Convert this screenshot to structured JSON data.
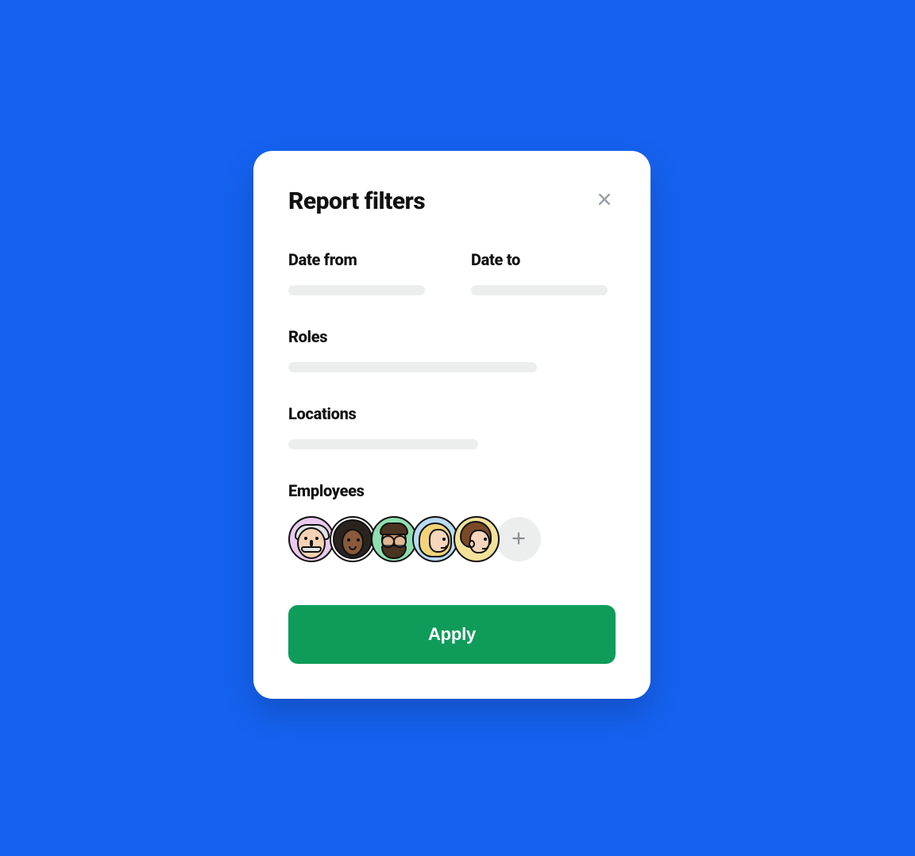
{
  "modal": {
    "title": "Report filters",
    "apply_label": "Apply"
  },
  "filters": {
    "date_from": {
      "label": "Date from",
      "value": ""
    },
    "date_to": {
      "label": "Date to",
      "value": ""
    },
    "roles": {
      "label": "Roles",
      "value": ""
    },
    "locations": {
      "label": "Locations",
      "value": ""
    },
    "employees": {
      "label": "Employees"
    }
  },
  "employees": [
    {
      "name": "employee-1",
      "bg": "#e9c9ee"
    },
    {
      "name": "employee-2",
      "bg": "#ffffff"
    },
    {
      "name": "employee-3",
      "bg": "#8fdeb0"
    },
    {
      "name": "employee-4",
      "bg": "#b9dbf5"
    },
    {
      "name": "employee-5",
      "bg": "#f2e29a"
    }
  ],
  "colors": {
    "background": "#1562f0",
    "primary_action": "#0f9c5a",
    "placeholder": "#eceeee"
  }
}
